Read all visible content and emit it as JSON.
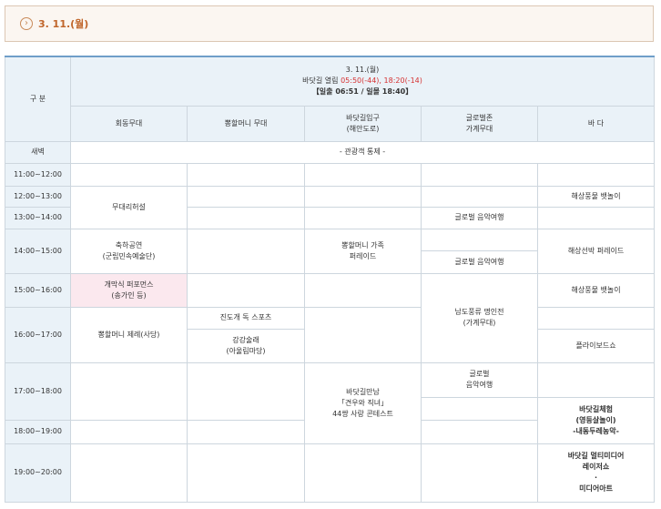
{
  "day_title": "3. 11.(월)",
  "header": {
    "corner": "구 분",
    "date": "3. 11.(월)",
    "tide_label": "바닷길 열림",
    "tide_times": "05:50(-44), 18:20(-14)",
    "sun_text": "【일출 06:51 / 일몰 18:40】"
  },
  "columns": [
    "회동무대",
    "뽕할머니 무대",
    "바닷길입구\n(해안도로)",
    "글로벌존\n가계무대",
    "바 다"
  ],
  "times": {
    "dawn": "새벽",
    "t1": "11:00~12:00",
    "t2": "12:00~13:00",
    "t3": "13:00~14:00",
    "t4": "14:00~15:00",
    "t5": "15:00~16:00",
    "t6": "16:00~17:00",
    "t7": "17:00~18:00",
    "t8": "18:00~19:00",
    "t9": "19:00~20:00"
  },
  "events": {
    "dawn": "- 관광객 통제 -",
    "rehearsal": "무대리허설",
    "haesan_1": "해상풍물 뱃놀이",
    "global_1": "글로벌 음악여행",
    "celebration": "축하공연\n(군립민속예술단)",
    "ppong_parade": "뽕할머니 가족\n퍼레이드",
    "global_2": "글로벌 음악여행",
    "haesan_parade": "해상선박 퍼레이드",
    "opening": "개막식 퍼포먼스\n(송가인 등)",
    "namdo": "남도풍류 명인전\n(가계무대)",
    "haesan_2": "해상풍물 뱃놀이",
    "jindo_sports": "진도개 독 스포츠",
    "ppong_ritual": "뽕할머니 제례(사당)",
    "ganggang": "강강술래\n(아울림마당)",
    "flyboard": "플라이보드쇼",
    "meeting": "바닷길만남\n「견우와 직녀」\n44쌍 사랑 콘테스트",
    "global_3": "글로벌\n음악여행",
    "experience": "바닷길체험\n(영등살놀이)\n-내동두레농악-",
    "media": "바닷길 멀티미디어\n레이저쇼\n·\n미디어아트"
  }
}
